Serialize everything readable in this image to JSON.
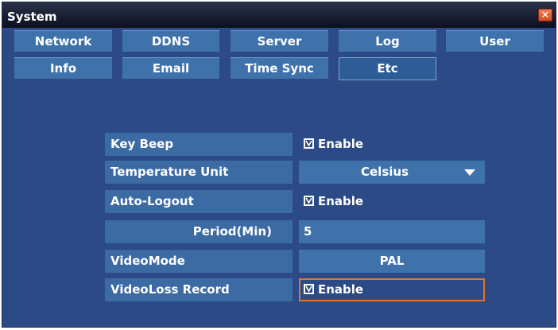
{
  "window": {
    "title": "System",
    "close_glyph": "✕"
  },
  "tabs": [
    {
      "label": "Network",
      "active": false
    },
    {
      "label": "DDNS",
      "active": false
    },
    {
      "label": "Server",
      "active": false
    },
    {
      "label": "Log",
      "active": false
    },
    {
      "label": "User",
      "active": false
    },
    {
      "label": "Info",
      "active": false
    },
    {
      "label": "Email",
      "active": false
    },
    {
      "label": "Time Sync",
      "active": false
    },
    {
      "label": "Etc",
      "active": true
    }
  ],
  "settings": {
    "key_beep": {
      "label": "Key Beep",
      "checked": true,
      "check_label": "Enable"
    },
    "temperature_unit": {
      "label": "Temperature Unit",
      "value": "Celsius"
    },
    "auto_logout": {
      "label": "Auto-Logout",
      "checked": true,
      "check_label": "Enable"
    },
    "period": {
      "label": "Period(Min)",
      "value": "5"
    },
    "video_mode": {
      "label": "VideoMode",
      "value": "PAL"
    },
    "videoloss_record": {
      "label": "VideoLoss Record",
      "checked": true,
      "check_label": "Enable",
      "focused": true
    }
  },
  "colors": {
    "panel": "#2b4a86",
    "tab": "#3f72ab",
    "label_bg": "#3c6aa3",
    "focus_border": "#e07530",
    "close_button": "#e0603a"
  }
}
